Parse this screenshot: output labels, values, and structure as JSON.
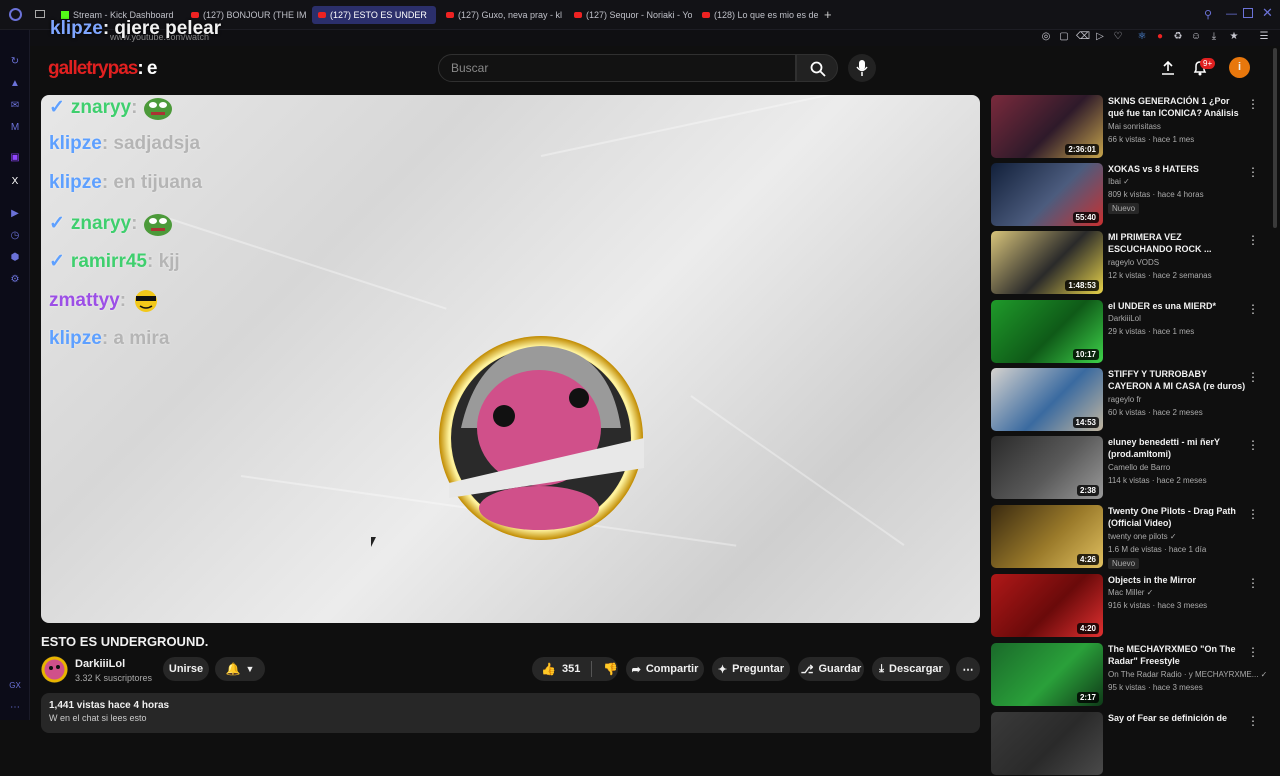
{
  "browser": {
    "tabs": [
      {
        "label": "Stream - Kick Dashboard",
        "type": "kick"
      },
      {
        "label": "(127) BONJOUR (THE IMP",
        "type": "yt"
      },
      {
        "label": "(127) ESTO ES UNDER",
        "type": "yt",
        "active": true
      },
      {
        "label": "(127) Guxo, neva pray - kl",
        "type": "yt"
      },
      {
        "label": "(127) Sequor - Noriaki - Yo",
        "type": "yt"
      },
      {
        "label": "(128) Lo que es mio es de",
        "type": "yt"
      }
    ],
    "url": "www.youtube.com/watch"
  },
  "overlay_top": {
    "user": "klipze",
    "message": "qiere pelear"
  },
  "header": {
    "logo_text": "galletrypas",
    "logo_suffix": ": e",
    "search_placeholder": "Buscar",
    "notif_count": "9+",
    "avatar_letter": "i"
  },
  "chat_overlay": [
    {
      "user": "znaryy",
      "message": "",
      "verified": true,
      "color": "green",
      "emote": "pepe"
    },
    {
      "user": "klipze",
      "message": ": sadjadsja",
      "verified": false,
      "color": "blue",
      "emote": ""
    },
    {
      "user": "klipze",
      "message": ": en tijuana",
      "verified": false,
      "color": "blue",
      "emote": ""
    },
    {
      "user": "znaryy",
      "message": "",
      "verified": true,
      "color": "green",
      "emote": "pepe"
    },
    {
      "user": "ramirr45",
      "message": ": kjj",
      "verified": true,
      "color": "green",
      "emote": ""
    },
    {
      "user": "zmattyy",
      "message": "",
      "verified": false,
      "color": "purple",
      "emote": "cool"
    },
    {
      "user": "klipze",
      "message": ": a mira",
      "verified": false,
      "color": "blue",
      "emote": ""
    }
  ],
  "video": {
    "title": "ESTO ES UNDERGROUND.",
    "channel": "DarkiiiLol",
    "subs": "3.32 K suscriptores",
    "join_label": "Unirse",
    "likes": "351",
    "share_label": "Compartir",
    "ask_label": "Preguntar",
    "save_label": "Guardar",
    "download_label": "Descargar",
    "views_meta": "1,441 vistas  hace 4 horas",
    "desc_snippet": "W en el chat si lees esto"
  },
  "recommendations": [
    {
      "title": "SKINS GENERACIÓN 1 ¿Por qué fue tan ICONICA? Análisis ...",
      "channel": "Mai sonrisitass",
      "stats": "66 k vistas · hace 1 mes",
      "duration": "2:36:01",
      "verified": false,
      "new": false,
      "colors": [
        "#7a2a3c",
        "#2e1a2a",
        "#c7a54c"
      ]
    },
    {
      "title": "XOKAS vs 8 HATERS",
      "channel": "Ibai",
      "stats": "809 k vistas · hace 4 horas",
      "duration": "55:40",
      "verified": true,
      "new": true,
      "colors": [
        "#12203a",
        "#4c5c7e",
        "#c83030"
      ]
    },
    {
      "title": "MI PRIMERA VEZ ESCUCHANDO ROCK ...",
      "channel": "rageylo VODS",
      "stats": "12 k vistas · hace 2 semanas",
      "duration": "1:48:53",
      "verified": false,
      "new": false,
      "colors": [
        "#d8c47a",
        "#2a2a2a",
        "#e8d34a"
      ]
    },
    {
      "title": "el UNDER es una MIERD*",
      "channel": "DarkiiiLol",
      "stats": "29 k vistas · hace 1 mes",
      "duration": "10:17",
      "verified": false,
      "new": false,
      "colors": [
        "#1f9a2a",
        "#0f5a18",
        "#3ed24a"
      ]
    },
    {
      "title": "STIFFY Y TURROBABY CAYERON A MI CASA (re duros)",
      "channel": "rageylo fr",
      "stats": "60 k vistas · hace 2 meses",
      "duration": "14:53",
      "verified": false,
      "new": false,
      "colors": [
        "#d6d3cf",
        "#3a6aa0",
        "#c2b6a0"
      ]
    },
    {
      "title": "eluney benedetti - mi ñerY (prod.amltomi)",
      "channel": "Camello de Barro",
      "stats": "114 k vistas · hace 2 meses",
      "duration": "2:38",
      "verified": false,
      "new": false,
      "colors": [
        "#2a2a2a",
        "#5a5a5a",
        "#9a9a9a"
      ]
    },
    {
      "title": "Twenty One Pilots - Drag Path (Official Video)",
      "channel": "twenty one pilots",
      "stats": "1.6 M de vistas · hace 1 día",
      "duration": "4:26",
      "verified": true,
      "new": true,
      "colors": [
        "#3a2a10",
        "#9a7a2a",
        "#e0c060"
      ]
    },
    {
      "title": "Objects in the Mirror",
      "channel": "Mac Miller",
      "stats": "916 k vistas · hace 3 meses",
      "duration": "4:20",
      "verified": true,
      "new": false,
      "colors": [
        "#b01818",
        "#6a0a0a",
        "#e03030"
      ]
    },
    {
      "title": "The MECHAYRXMEO \"On The Radar\" Freestyle",
      "channel": "On The Radar Radio · y MECHAYRXME...",
      "stats": "95 k vistas · hace 3 meses",
      "duration": "2:17",
      "verified": true,
      "new": false,
      "colors": [
        "#1a6a2a",
        "#2aa03a",
        "#0f3a18"
      ]
    },
    {
      "title": "Say of Fear se definición de",
      "channel": "",
      "stats": "",
      "duration": "",
      "verified": false,
      "new": false,
      "colors": [
        "#3a3a3a",
        "#2a2a2a",
        "#4a4a4a"
      ]
    }
  ]
}
